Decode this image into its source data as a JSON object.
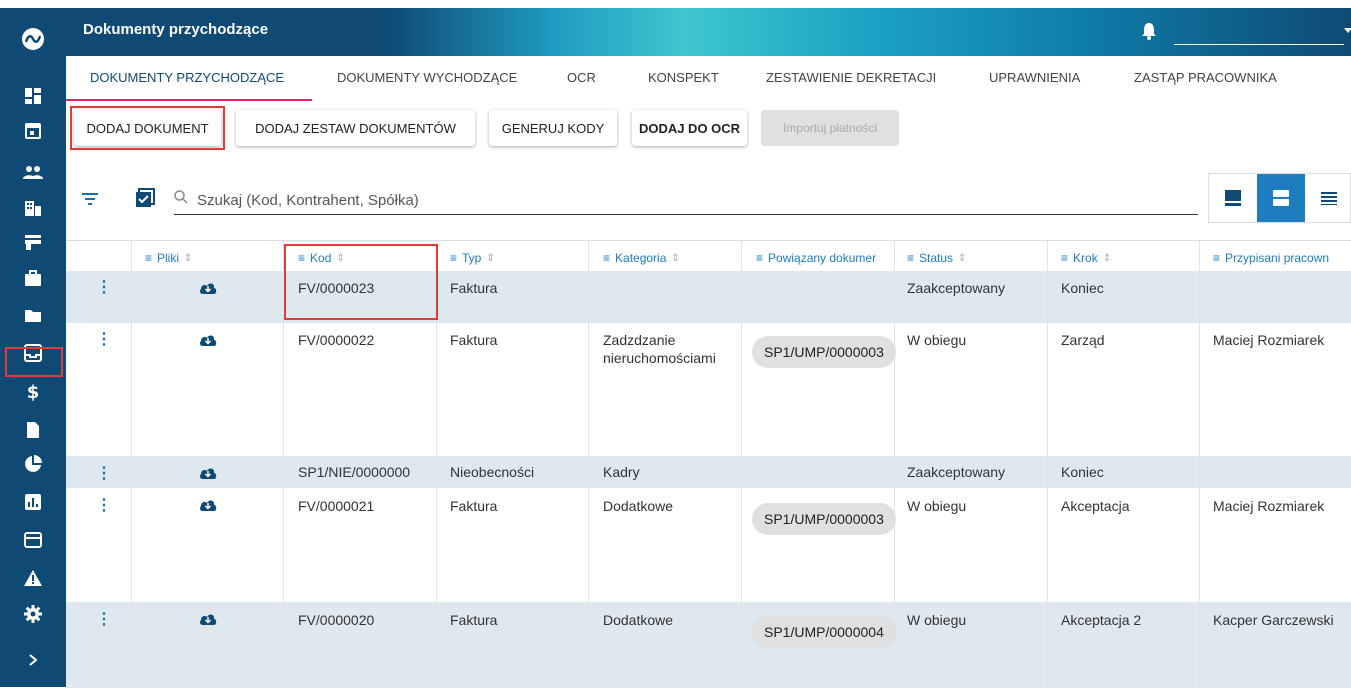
{
  "header": {
    "title": "Dokumenty przychodzące"
  },
  "tabs": [
    {
      "label": "DOKUMENTY PRZYCHODZĄCE",
      "active": true
    },
    {
      "label": "DOKUMENTY WYCHODZĄCE"
    },
    {
      "label": "OCR"
    },
    {
      "label": "KONSPEKT"
    },
    {
      "label": "ZESTAWIENIE DEKRETACJI"
    },
    {
      "label": "UPRAWNIENIA"
    },
    {
      "label": "ZASTĄP PRACOWNIKA"
    }
  ],
  "toolbar": {
    "add_document": "DODAJ DOKUMENT",
    "add_document_set": "DODAJ ZESTAW DOKUMENTÓW",
    "generate_codes": "GENERUJ KODY",
    "add_to_ocr": "DODAJ DO OCR",
    "import_payments": "Importuj płatności"
  },
  "search": {
    "placeholder": "Szukaj (Kod, Kontrahent, Spółka)"
  },
  "table": {
    "columns": [
      "Pliki",
      "Kod",
      "Typ",
      "Kategoria",
      "Powiązany dokumer",
      "Status",
      "Krok",
      "Przypisani pracown"
    ],
    "rows": [
      {
        "kod": "FV/0000023",
        "typ": "Faktura",
        "kategoria": "",
        "powiazany": "",
        "status": "Zaakceptowany",
        "krok": "Koniec",
        "pracownik": ""
      },
      {
        "kod": "FV/0000022",
        "typ": "Faktura",
        "kategoria": "Zadzdzanie nieruchomościami",
        "powiazany": "SP1/UMP/0000003",
        "status": "W obiegu",
        "krok": "Zarząd",
        "pracownik": "Maciej Rozmiarek"
      },
      {
        "kod": "SP1/NIE/0000000",
        "typ": "Nieobecności",
        "kategoria": "Kadry",
        "powiazany": "",
        "status": "Zaakceptowany",
        "krok": "Koniec",
        "pracownik": ""
      },
      {
        "kod": "FV/0000021",
        "typ": "Faktura",
        "kategoria": "Dodatkowe",
        "powiazany": "SP1/UMP/0000003",
        "status": "W obiegu",
        "krok": "Akceptacja",
        "pracownik": "Maciej Rozmiarek"
      },
      {
        "kod": "FV/0000020",
        "typ": "Faktura",
        "kategoria": "Dodatkowe",
        "powiazany": "SP1/UMP/0000004",
        "status": "W obiegu",
        "krok": "Akceptacja 2",
        "pracownik": "Kacper Garczewski"
      }
    ]
  },
  "icons": {
    "row_menu": "⋮"
  },
  "colors": {
    "sidebar": "#0f4a75",
    "accent": "#1e7cc0",
    "tab_underline": "#e91e63",
    "highlight": "#e53935",
    "row_shade": "#dfe8ef"
  }
}
